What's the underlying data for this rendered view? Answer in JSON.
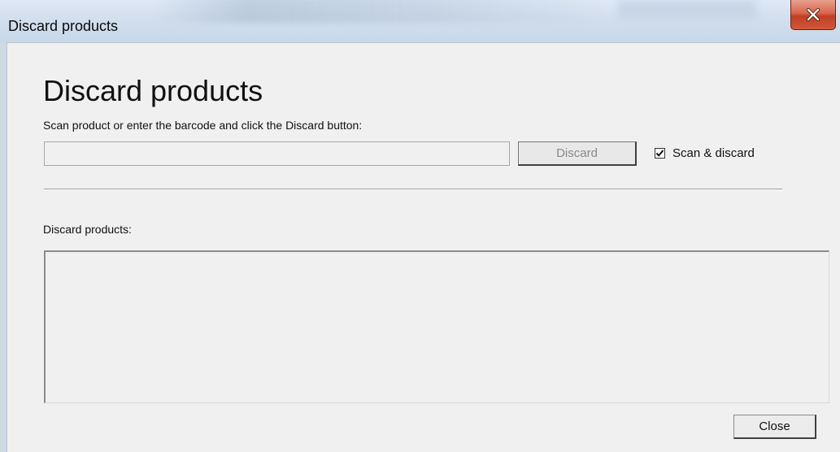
{
  "window": {
    "title": "Discard products",
    "close_icon": "close-icon"
  },
  "dialog": {
    "heading": "Discard products",
    "instruction": "Scan product or enter the barcode and click the Discard button:",
    "barcode_input": {
      "value": "",
      "placeholder": ""
    },
    "discard_label": "Discard",
    "scan_discard": {
      "label": "Scan & discard",
      "checked": true
    },
    "list_label": "Discard products:",
    "products": [],
    "close_label": "Close"
  }
}
